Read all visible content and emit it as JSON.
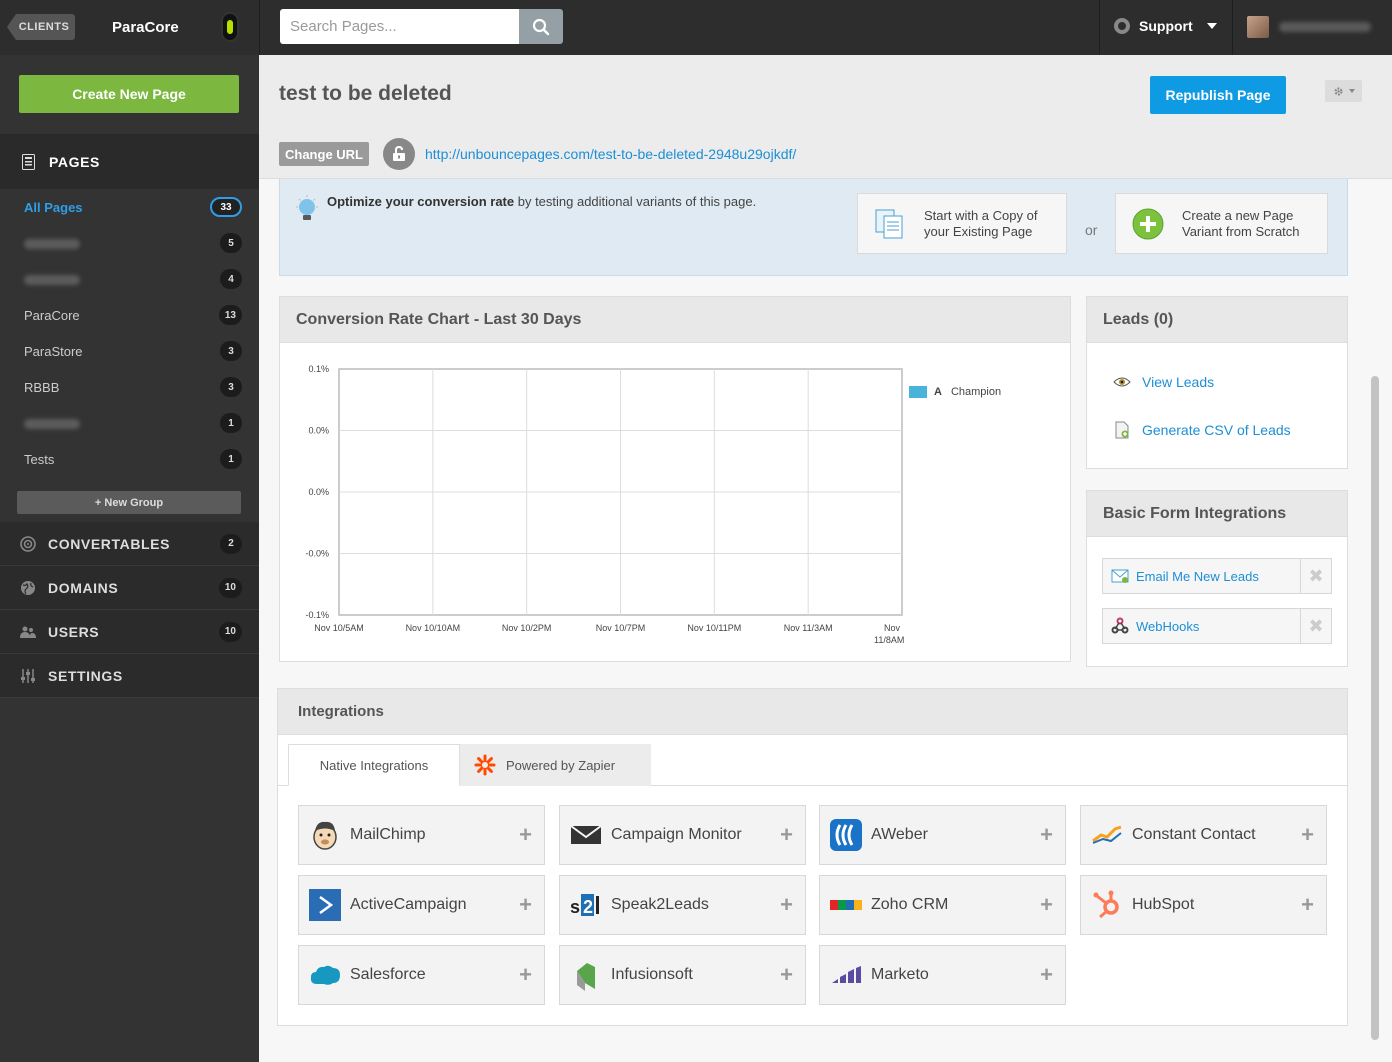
{
  "topbar": {
    "clients_label": "CLIENTS",
    "client_name": "ParaCore",
    "search_placeholder": "Search Pages...",
    "support_label": "Support"
  },
  "sidebar": {
    "create_button": "Create New Page",
    "pages_title": "PAGES",
    "pages": [
      {
        "label": "All Pages",
        "count": "33"
      },
      {
        "label": "",
        "count": "5"
      },
      {
        "label": "",
        "count": "4"
      },
      {
        "label": "ParaCore",
        "count": "13"
      },
      {
        "label": "ParaStore",
        "count": "3"
      },
      {
        "label": "RBBB",
        "count": "3"
      },
      {
        "label": "",
        "count": "1"
      },
      {
        "label": "Tests",
        "count": "1"
      }
    ],
    "new_group": "+ New Group",
    "nav": [
      {
        "label": "CONVERTABLES",
        "count": "2",
        "icon": "target-icon"
      },
      {
        "label": "DOMAINS",
        "count": "10",
        "icon": "globe-icon"
      },
      {
        "label": "USERS",
        "count": "10",
        "icon": "users-icon"
      },
      {
        "label": "SETTINGS",
        "count": "",
        "icon": "sliders-icon"
      }
    ]
  },
  "header": {
    "title": "test to be deleted",
    "republish": "Republish Page",
    "change_url": "Change URL",
    "url": "http://unbouncepages.com/test-to-be-deleted-2948u29ojkdf/"
  },
  "optimize": {
    "bold": "Optimize your conversion rate",
    "rest": " by testing additional variants of this page.",
    "copy_line1": "Start with a Copy of",
    "copy_line2": "your Existing Page",
    "or": "or",
    "new_line1": "Create a new Page",
    "new_line2": "Variant from Scratch"
  },
  "chart_panel": {
    "title": "Conversion Rate Chart - Last 30 Days"
  },
  "chart_data": {
    "type": "line",
    "title": "Conversion Rate Chart - Last 30 Days",
    "y_tick_labels": [
      "0.1%",
      "0.0%",
      "0.0%",
      "-0.0%",
      "-0.1%"
    ],
    "x_tick_labels": [
      "Nov 10/5AM",
      "Nov 10/10AM",
      "Nov 10/2PM",
      "Nov 10/7PM",
      "Nov 10/11PM",
      "Nov 11/3AM",
      "Nov 11/8AM"
    ],
    "grid": true,
    "legend": "right",
    "series": [
      {
        "name": "Champion",
        "variant": "A",
        "color": "#4ab3d9",
        "values": []
      }
    ]
  },
  "leads": {
    "title": "Leads (0)",
    "view": "View Leads",
    "csv": "Generate CSV of Leads"
  },
  "form_integrations": {
    "title": "Basic Form Integrations",
    "items": [
      "Email Me New Leads",
      "WebHooks"
    ]
  },
  "integrations": {
    "title": "Integrations",
    "tabs": [
      "Native Integrations",
      "Powered by Zapier"
    ],
    "items": [
      "MailChimp",
      "Campaign Monitor",
      "AWeber",
      "Constant Contact",
      "ActiveCampaign",
      "Speak2Leads",
      "Zoho CRM",
      "HubSpot",
      "Salesforce",
      "Infusionsoft",
      "Marketo"
    ]
  },
  "colors": {
    "accent_blue": "#0f9be4",
    "create_green": "#7cb73f",
    "link_blue": "#1c8fd6"
  }
}
